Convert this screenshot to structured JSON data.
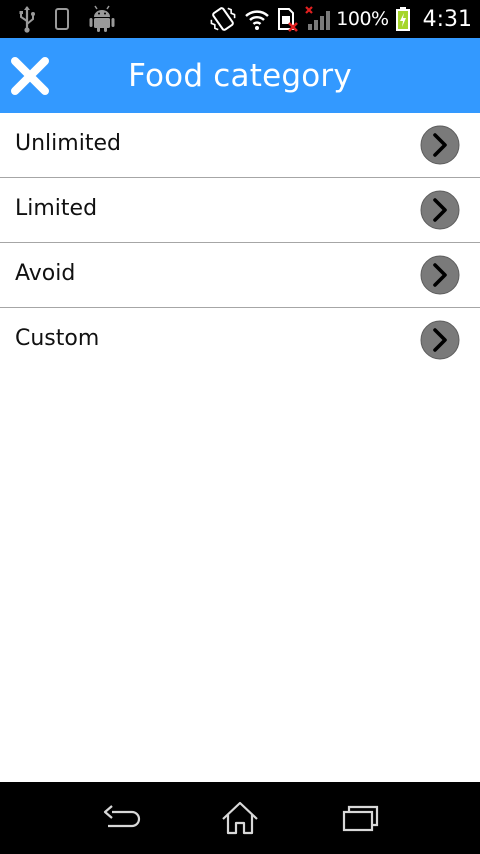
{
  "status_bar": {
    "battery_level": "100%",
    "time": "4:31",
    "icons": [
      "usb-icon",
      "phone-icon",
      "android-icon",
      "vibrate-icon",
      "wifi-icon",
      "sim-disabled-icon",
      "signal-icon",
      "battery-charging-icon"
    ]
  },
  "app_bar": {
    "title": "Food category",
    "close_icon": "close-icon",
    "background_color": "#3399ff"
  },
  "categories": [
    {
      "label": "Unlimited",
      "icon": "chevron-right-icon"
    },
    {
      "label": "Limited",
      "icon": "chevron-right-icon"
    },
    {
      "label": "Avoid",
      "icon": "chevron-right-icon"
    },
    {
      "label": "Custom",
      "icon": "chevron-right-icon"
    }
  ],
  "nav_bar": {
    "buttons": [
      "back-icon",
      "home-icon",
      "recent-apps-icon"
    ]
  }
}
